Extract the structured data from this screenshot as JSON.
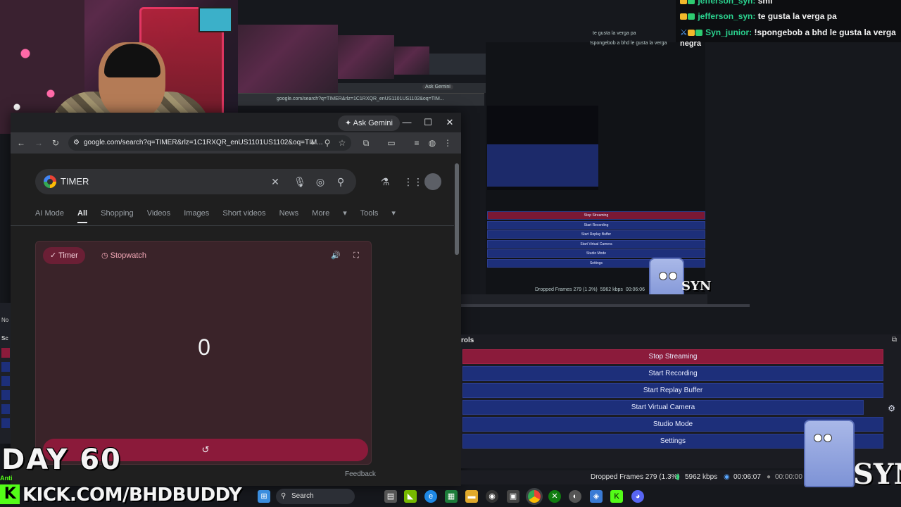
{
  "chat": {
    "lines": [
      {
        "name": "jefferson_syn:",
        "msg": "smi"
      },
      {
        "name": "jefferson_syn:",
        "msg": "te gusta la verga pa"
      },
      {
        "name": "Syn_junior:",
        "msg": "!spongebob a bhd le gusta la verga"
      },
      {
        "name": "",
        "msg": "negra"
      }
    ]
  },
  "nested": {
    "ask_gemini": "Ask Gemini",
    "url_snippet": "google.com/search?q=TIMER&rlz=1C1RXQR_enUS1101US1102&oq=TIM...",
    "chat_line": "te gusta la verga pa",
    "chat_line2": "!spongebob a bhd le gusta la verga",
    "mini_buttons": [
      "Stop Streaming",
      "Start Recording",
      "Start Replay Buffer",
      "Start Virtual Camera",
      "Studio Mode",
      "Settings"
    ],
    "mini_status": "Dropped Frames 279 (1.3%)",
    "mini_kbps": "5962 kbps",
    "mini_time": "00:06:06"
  },
  "browser": {
    "ask_gemini": "Ask Gemini",
    "url": "google.com/search?q=TIMER&rlz=1C1RXQR_enUS1101US1102&oq=TIM...",
    "query": "TIMER",
    "tabs": [
      "AI Mode",
      "All",
      "Shopping",
      "Videos",
      "Images",
      "Short videos",
      "News",
      "More",
      "Tools"
    ],
    "timer_label": "Timer",
    "stopwatch_label": "Stopwatch",
    "timer_value": "0",
    "reset_icon": "↺",
    "feedback": "Feedback"
  },
  "obs": {
    "controls_title": "rols",
    "buttons": [
      "Stop Streaming",
      "Start Recording",
      "Start Replay Buffer",
      "Start Virtual Camera",
      "Studio Mode",
      "Settings"
    ],
    "dropped": "Dropped Frames 279 (1.3%)",
    "kbps": "5962 kbps",
    "stream_time": "00:06:07",
    "rec_time": "00:00:00",
    "colors": {
      "stream": "#8b1b3b",
      "button": "#1d2f7a"
    }
  },
  "left_panel": {
    "labels": [
      "No",
      "Sc"
    ]
  },
  "overlay": {
    "day": "DAY 60",
    "kick": "KICK.COM/BHDBUDDY",
    "kick_k": "K",
    "anti": "Anti",
    "syn": "SYN"
  },
  "taskbar": {
    "search": "Search",
    "icons": [
      "windows-icon",
      "search-icon",
      "files-icon",
      "nvidia-icon",
      "edge-icon",
      "spreadsheet-icon",
      "folder-icon",
      "obs-icon",
      "store-icon",
      "chrome-icon",
      "xbox-icon",
      "steam-icon",
      "app-icon",
      "kick-icon",
      "discord-icon"
    ]
  }
}
